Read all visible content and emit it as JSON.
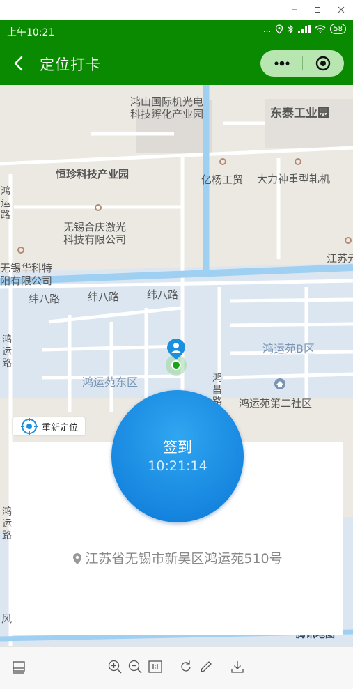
{
  "status_bar": {
    "time": "上午10:21",
    "dots": "...",
    "battery": "58"
  },
  "nav": {
    "title": "定位打卡"
  },
  "map": {
    "labels": [
      "鸿山国际机光电",
      "科技孵化产业园",
      "东泰工业园",
      "恒珍科技产业园",
      "亿杨工贸",
      "大力神重型轧机",
      "鸿运路",
      "无锡合庆激光",
      "科技有限公司",
      "江苏元",
      "无锡华科特",
      "阳有限公司",
      "纬八路",
      "纬八路",
      "纬八路",
      "鸿运苑B区",
      "鸿运路",
      "鸿运苑东区",
      "鸿昌路",
      "鸿运苑第二社区",
      "鸿运路",
      "风",
      "腾讯地图"
    ],
    "relocate_label": "重新定位"
  },
  "checkin": {
    "label": "签到",
    "time": "10:21:14"
  },
  "address": "江苏省无锡市新吴区鸿运苑510号"
}
